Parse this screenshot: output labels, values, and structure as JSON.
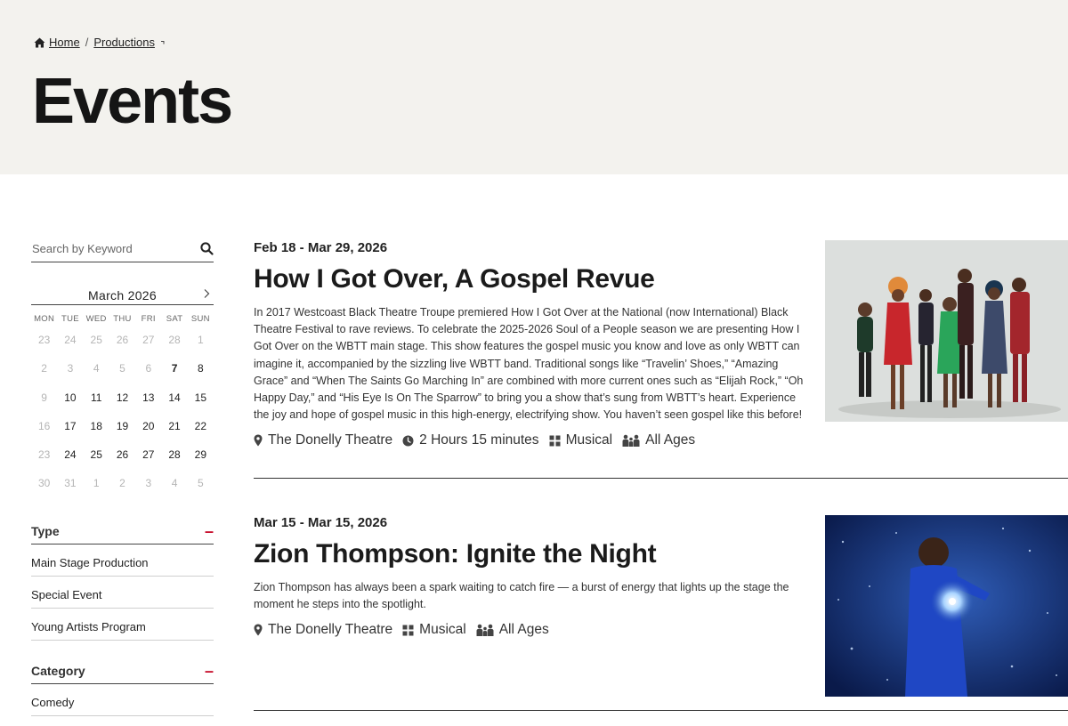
{
  "breadcrumb": {
    "home": "Home",
    "sep": "/",
    "productions": "Productions"
  },
  "page": {
    "title": "Events"
  },
  "search": {
    "placeholder": "Search by Keyword"
  },
  "calendar": {
    "month": "March 2026",
    "weekdays": [
      "MON",
      "TUE",
      "WED",
      "THU",
      "FRI",
      "SAT",
      "SUN"
    ],
    "days": [
      {
        "d": "23",
        "m": true
      },
      {
        "d": "24",
        "m": true
      },
      {
        "d": "25",
        "m": true
      },
      {
        "d": "26",
        "m": true
      },
      {
        "d": "27",
        "m": true
      },
      {
        "d": "28",
        "m": true
      },
      {
        "d": "1",
        "m": true
      },
      {
        "d": "2",
        "m": true
      },
      {
        "d": "3",
        "m": true
      },
      {
        "d": "4",
        "m": true
      },
      {
        "d": "5",
        "m": true
      },
      {
        "d": "6",
        "m": true
      },
      {
        "d": "7",
        "m": false,
        "today": true
      },
      {
        "d": "8",
        "m": false
      },
      {
        "d": "9",
        "m": true
      },
      {
        "d": "10",
        "m": false
      },
      {
        "d": "11",
        "m": false
      },
      {
        "d": "12",
        "m": false
      },
      {
        "d": "13",
        "m": false
      },
      {
        "d": "14",
        "m": false
      },
      {
        "d": "15",
        "m": false
      },
      {
        "d": "16",
        "m": true
      },
      {
        "d": "17",
        "m": false
      },
      {
        "d": "18",
        "m": false
      },
      {
        "d": "19",
        "m": false
      },
      {
        "d": "20",
        "m": false
      },
      {
        "d": "21",
        "m": false
      },
      {
        "d": "22",
        "m": false
      },
      {
        "d": "23",
        "m": true
      },
      {
        "d": "24",
        "m": false
      },
      {
        "d": "25",
        "m": false
      },
      {
        "d": "26",
        "m": false
      },
      {
        "d": "27",
        "m": false
      },
      {
        "d": "28",
        "m": false
      },
      {
        "d": "29",
        "m": false
      },
      {
        "d": "30",
        "m": true
      },
      {
        "d": "31",
        "m": true
      },
      {
        "d": "1",
        "m": true
      },
      {
        "d": "2",
        "m": true
      },
      {
        "d": "3",
        "m": true
      },
      {
        "d": "4",
        "m": true
      },
      {
        "d": "5",
        "m": true
      }
    ]
  },
  "filters": {
    "type": {
      "title": "Type",
      "toggle": "–",
      "items": [
        "Main Stage Production",
        "Special Event",
        "Young Artists Program"
      ]
    },
    "category": {
      "title": "Category",
      "toggle": "–",
      "items": [
        "Comedy"
      ]
    }
  },
  "events": [
    {
      "date": "Feb 18 - Mar 29, 2026",
      "title": "How I Got Over, A Gospel Revue",
      "description": "In 2017 Westcoast Black Theatre Troupe premiered How I Got Over at the National (now International) Black Theatre Festival to rave reviews. To celebrate the 2025-2026 Soul of a People season we are presenting How I Got Over on the WBTT main stage. This show features the gospel music you know and love as only WBTT can imagine it, accompanied by the sizzling live WBTT band. Traditional songs like “Travelin’ Shoes,” “Amazing Grace” and “When The Saints Go Marching In” are combined with more current ones such as “Elijah Rock,” “Oh Happy Day,” and “His Eye Is On The Sparrow” to bring you a show that’s sung from WBTT’s heart. Experience the joy and hope of gospel music in this high-energy, electrifying show. You haven’t seen gospel like this before!",
      "venue": "The Donelly Theatre",
      "duration": "2 Hours 15 minutes",
      "genre": "Musical",
      "audience": "All Ages"
    },
    {
      "date": "Mar 15 - Mar 15, 2026",
      "title": "Zion Thompson: Ignite the Night",
      "description": "Zion Thompson has always been a spark waiting to catch fire — a burst of energy that lights up the stage the moment he steps into the spotlight.",
      "venue": "The Donelly Theatre",
      "genre": "Musical",
      "audience": "All Ages"
    }
  ],
  "colors": {
    "hero_bg": "#f3f2ee",
    "accent_red": "#c8102e",
    "text": "#222222"
  }
}
